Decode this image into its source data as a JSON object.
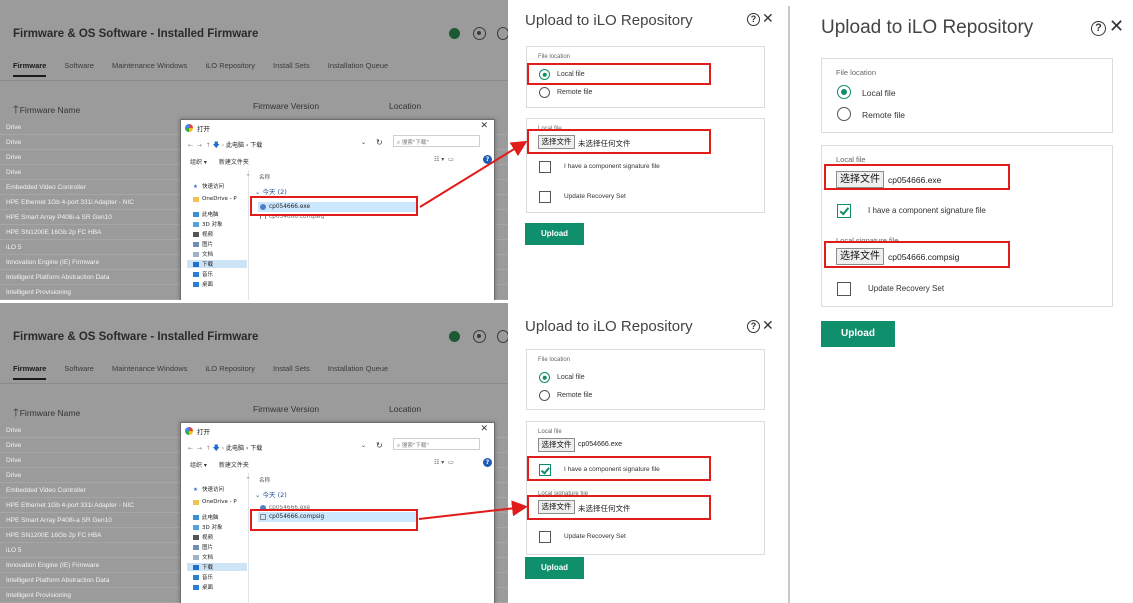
{
  "firmware_window": {
    "title": "Firmware & OS Software - Installed Firmware",
    "tabs": [
      "Firmware",
      "Software",
      "Maintenance Windows",
      "iLO Repository",
      "Install Sets",
      "Installation Queue"
    ],
    "col_name": "Firmware Name",
    "col_version": "Firmware Version",
    "col_location": "Location",
    "rows": [
      "Drive",
      "Drive",
      "Drive",
      "Drive",
      "Embedded Video Controller",
      "HPE Ethernet 1Gb 4-port 331i Adapter - NIC",
      "HPE Smart Array P408i-a SR Gen10",
      "HPE SN1200E 16Gb 2p FC HBA",
      "iLO 5",
      "Innovation Engine (IE) Firmware",
      "Intelligent Platform Abstraction Data",
      "Intelligent Provisioning"
    ]
  },
  "open_dialog": {
    "title": "打开",
    "close": "✕",
    "nav_path": "此电脑 › 下载",
    "search_placeholder": "搜索\"下载\"",
    "organize": "组织 ▾",
    "new_folder": "新建文件夹",
    "sidebar": [
      "快速访问",
      "OneDrive - P",
      "此电脑",
      "3D 对象",
      "视频",
      "图片",
      "文档",
      "下载",
      "音乐",
      "桌面"
    ],
    "column_name": "名称",
    "group": "今天 (2)",
    "files": [
      "cp054666.exe",
      "cp054666.compsig"
    ]
  },
  "upload_panel": {
    "title": "Upload to iLO Repository",
    "help": "?",
    "close": "✕",
    "file_location_label": "File location",
    "local_file": "Local file",
    "remote_file": "Remote file",
    "local_file_label": "Local file",
    "local_sig_label": "Local signature file",
    "choose_file": "选择文件",
    "no_file": "未选择任何文件",
    "exe_name": "cp054666.exe",
    "sig_name": "cp054666.compsig",
    "component_sig": "I have a component signature file",
    "update_recovery": "Update Recovery Set",
    "upload": "Upload"
  },
  "colors": {
    "accent": "#0f8f6b",
    "highlight": "#e21b1b",
    "selected": "#cce8ff"
  }
}
